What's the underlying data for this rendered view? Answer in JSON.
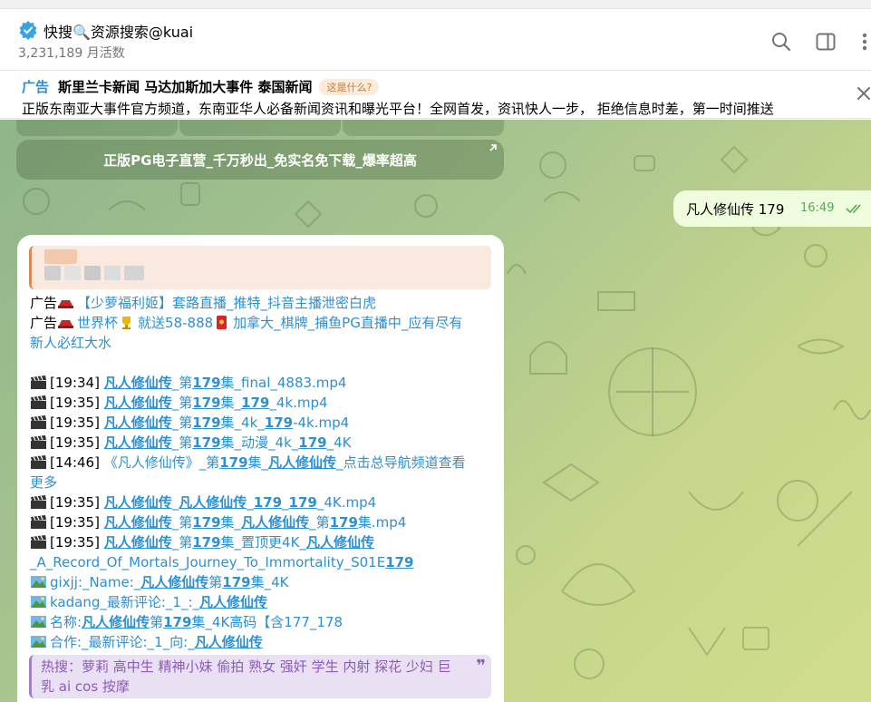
{
  "header": {
    "title": "快搜🔍资源搜索@kuai",
    "subtitle": "3,231,189 月活数"
  },
  "ad_bar": {
    "tag": "广告",
    "title": "斯里兰卡新闻 马达加斯加大事件 泰国新闻",
    "what": "这是什么?",
    "description": "正版东南亚大事件官方频道，东南亚华人必备新闻资讯和曝光平台！全网首发，资讯快人一步， 拒绝信息时差，第一时间推送"
  },
  "keyboard": {
    "button_label": "正版PG电子直营_千万秒出_免实名免下载_爆率超高"
  },
  "outgoing": {
    "text": "凡人修仙传 179",
    "time": "16:49"
  },
  "incoming": {
    "ad1": {
      "prefix": "广告",
      "text": "【少萝福利姬】套路直播_推特_抖音主播泄密白虎"
    },
    "ad2": {
      "prefix": "广告",
      "text_a": "世界杯",
      "text_b": "就送58-888",
      "text_c": "加拿大_棋牌_捕鱼PG直播中_应有尽有",
      "text_d": "新人必红大水"
    },
    "r1": {
      "time": "[19:34] ",
      "a": "凡人修仙传",
      "b": "_第",
      "c": "179",
      "d": "集_final_4883.mp4"
    },
    "r2": {
      "time": "[19:35] ",
      "a": "凡人修仙传",
      "b": "_第",
      "c": "179",
      "d": "集_",
      "e": "179",
      "f": "_4k.mp4"
    },
    "r3": {
      "time": "[19:35] ",
      "a": "凡人修仙传",
      "b": "_第",
      "c": "179",
      "d": "集_4k_",
      "e": "179",
      "f": "-4k.mp4"
    },
    "r4": {
      "time": "[19:35] ",
      "a": "凡人修仙传",
      "b": "_第",
      "c": "179",
      "d": "集_动漫_4k_",
      "e": "179",
      "f": "_4K"
    },
    "r5": {
      "time": "[14:46] ",
      "a": "《凡人修仙传》_第",
      "b": "179",
      "c": "集_",
      "d": "凡人修仙传",
      "e": "_点击总导航频道查看",
      "f": "更多"
    },
    "r6": {
      "time": "[19:35] ",
      "a": "凡人修仙传",
      "b": "_",
      "c": "凡人修仙传",
      "d": "_",
      "e": "179",
      "f": "_",
      "g": "179",
      "h": "_4K.mp4"
    },
    "r7": {
      "time": "[19:35] ",
      "a": "凡人修仙传",
      "b": "_第",
      "c": "179",
      "d": "集_",
      "e": "凡人修仙传",
      "f": "_第",
      "g": "179",
      "h": "集.mp4"
    },
    "r8": {
      "time": "[19:35] ",
      "a": "凡人修仙传",
      "b": "_第",
      "c": "179",
      "d": "集_置顶更4K_",
      "e": "凡人修仙传",
      "f": "_A_Record_Of_Mortals_Journey_To_Immortality_S01E",
      "g": "179"
    },
    "r9": {
      "a": "gixjj:_Name:_",
      "b": "凡人修仙传",
      "c": "第",
      "d": "179",
      "e": "集_4K"
    },
    "r10": {
      "a": "kadang_最新评论:_1_:_",
      "b": "凡人修仙传"
    },
    "r11": {
      "a": "名称:",
      "b": "凡人修仙传",
      "c": "第",
      "d": "179",
      "e": "集_4K高码【含177_178"
    },
    "r12": {
      "a": "合作:_最新评论:_1_向:_",
      "b": "凡人修仙传"
    },
    "hot_search": {
      "line1": "热搜：萝莉 高中生 精神小妹 偷拍 熟女 强奸 学生 内射 探花 少妇 巨",
      "line2": "乳 ai cos 按摩"
    }
  },
  "colors": {
    "accent": "#2e8fd1",
    "outgoing_bubble": "#effdde",
    "time_green": "#4fae4e",
    "hot_purple": "#8c5cb8"
  },
  "icons": [
    "verified-icon",
    "search-icon",
    "sidebar-toggle-icon",
    "more-vertical-icon",
    "close-icon",
    "open-link-icon",
    "double-check-icon",
    "clapper-icon",
    "picture-icon",
    "hat-icon",
    "trophy-icon",
    "red-envelope-icon"
  ]
}
